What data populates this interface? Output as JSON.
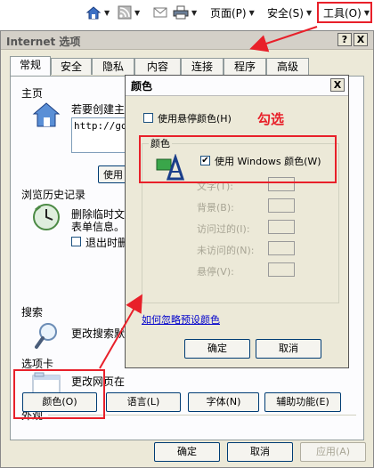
{
  "toolbar": {
    "page_label": "页面(P)",
    "safety_label": "安全(S)",
    "tools_label": "工具(O)"
  },
  "window": {
    "title": "Internet 选项",
    "help_btn": "?",
    "close_btn": "X",
    "tabs": [
      "常规",
      "安全",
      "隐私",
      "内容",
      "连接",
      "程序",
      "高级"
    ],
    "home": {
      "label": "主页",
      "desc": "若要创建主",
      "url": "http://go.",
      "use_btn": "使用"
    },
    "history": {
      "label": "浏览历史记录",
      "desc1": "删除临时文",
      "desc2": "表单信息。",
      "exit_label": "退出时删"
    },
    "search": {
      "label": "搜索",
      "desc": "更改搜索默"
    },
    "tabs_section": {
      "label": "选项卡",
      "desc": "更改网页在"
    },
    "appearance": {
      "label": "外观",
      "colors_btn": "颜色(O)",
      "languages_btn": "语言(L)",
      "fonts_btn": "字体(N)",
      "accessibility_btn": "辅助功能(E)"
    },
    "ok_btn": "确定",
    "cancel_btn": "取消",
    "apply_btn": "应用(A)"
  },
  "dialog": {
    "title": "颜色",
    "close_btn": "X",
    "hover_colors_label": "使用悬停颜色(H)",
    "annotation": "勾选",
    "group_label": "颜色",
    "use_windows_label": "使用 Windows 颜色(W)",
    "use_windows_checked": true,
    "color_rows": [
      "文字(T):",
      "背景(B):",
      "访问过的(I):",
      "未访问的(N):",
      "悬停(V):"
    ],
    "ignore_link": "如何忽略预设颜色",
    "ok_btn": "确定",
    "cancel_btn": "取消"
  },
  "colors": {
    "highlight": "#e8202a",
    "dialog_bg": "#ece9d8",
    "link": "#0000cc"
  }
}
